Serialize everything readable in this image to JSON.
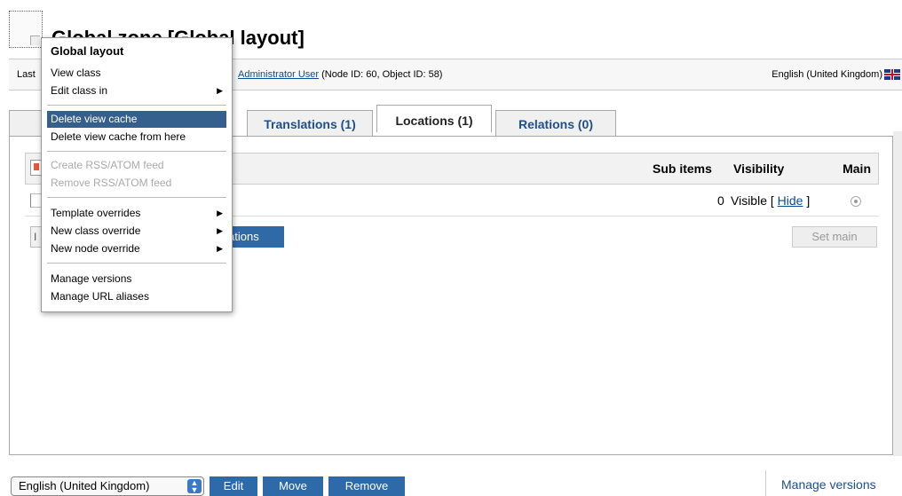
{
  "page": {
    "title": "Global zone [Global layout]",
    "last_label": "Last",
    "owner_name": "Administrator User",
    "owner_ids": "(Node ID: 60, Object ID: 58)",
    "language": "English (United Kingdom)"
  },
  "tabs": {
    "translations": "Translations (1)",
    "locations": "Locations (1)",
    "relations": "Relations (0)"
  },
  "table": {
    "col_sub_items": "Sub items",
    "col_visibility": "Visibility",
    "col_main": "Main",
    "row": {
      "sub_items": "0",
      "visibility": "Visible [",
      "hide_link": "Hide",
      "close_bracket": "]"
    }
  },
  "buttons": {
    "add_locations_fragment": "ations",
    "set_main": "Set main",
    "left_stub": "I",
    "edit": "Edit",
    "move": "Move",
    "remove": "Remove"
  },
  "bottom": {
    "language_select": "English (United Kingdom)",
    "manage_versions": "Manage versions"
  },
  "context_menu": {
    "title": "Global layout",
    "items": [
      {
        "label": "View class",
        "state": "normal"
      },
      {
        "label": "Edit class in",
        "state": "normal",
        "submenu": true
      },
      {
        "label": "Delete view cache",
        "state": "selected"
      },
      {
        "label": "Delete view cache from here",
        "state": "normal"
      },
      {
        "label": "Create RSS/ATOM feed",
        "state": "disabled"
      },
      {
        "label": "Remove RSS/ATOM feed",
        "state": "disabled"
      },
      {
        "label": "Template overrides",
        "state": "normal",
        "submenu": true
      },
      {
        "label": "New class override",
        "state": "normal",
        "submenu": true
      },
      {
        "label": "New node override",
        "state": "normal",
        "submenu": true
      },
      {
        "label": "Manage versions",
        "state": "normal"
      },
      {
        "label": "Manage URL aliases",
        "state": "normal"
      }
    ]
  },
  "colors": {
    "button_blue": "#2f6aa8",
    "menu_selected": "#355f8c",
    "tab_text": "#1f4f8a",
    "link": "#0b4c95"
  }
}
